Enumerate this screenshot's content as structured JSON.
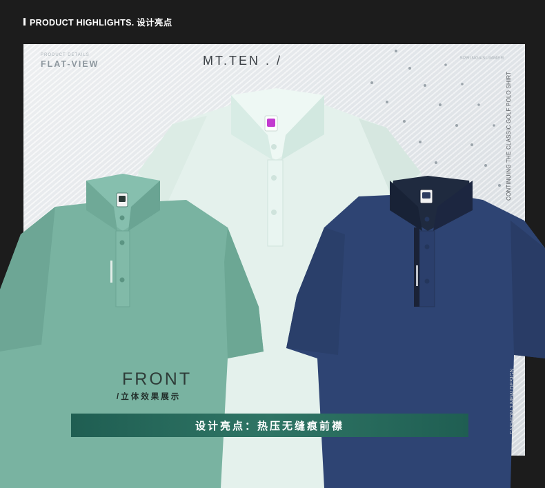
{
  "header": {
    "title": "PRODUCT HIGHLIGHTS. 设计亮点"
  },
  "panel": {
    "product_details": "PRODUCT DETAILS",
    "flat_view": "FLAT-VIEW",
    "brand": "MT.TEN . /",
    "season": "SPRING&SUMMER",
    "vertical_text": "CONTINUING THE CLASSIC GOLF POLO SHIRT",
    "vertical_text_2": "FASHION 2 NEW DESIGN"
  },
  "caption": {
    "title": "FRONT",
    "subtitle": "/立体效果展示"
  },
  "banner": {
    "text": "设计亮点：热压无缝痕前襟"
  },
  "colors": {
    "mint": "#78b3a0",
    "white_shirt": "#e6f3ef",
    "navy": "#2d4575",
    "banner": "#2a6b5c"
  }
}
